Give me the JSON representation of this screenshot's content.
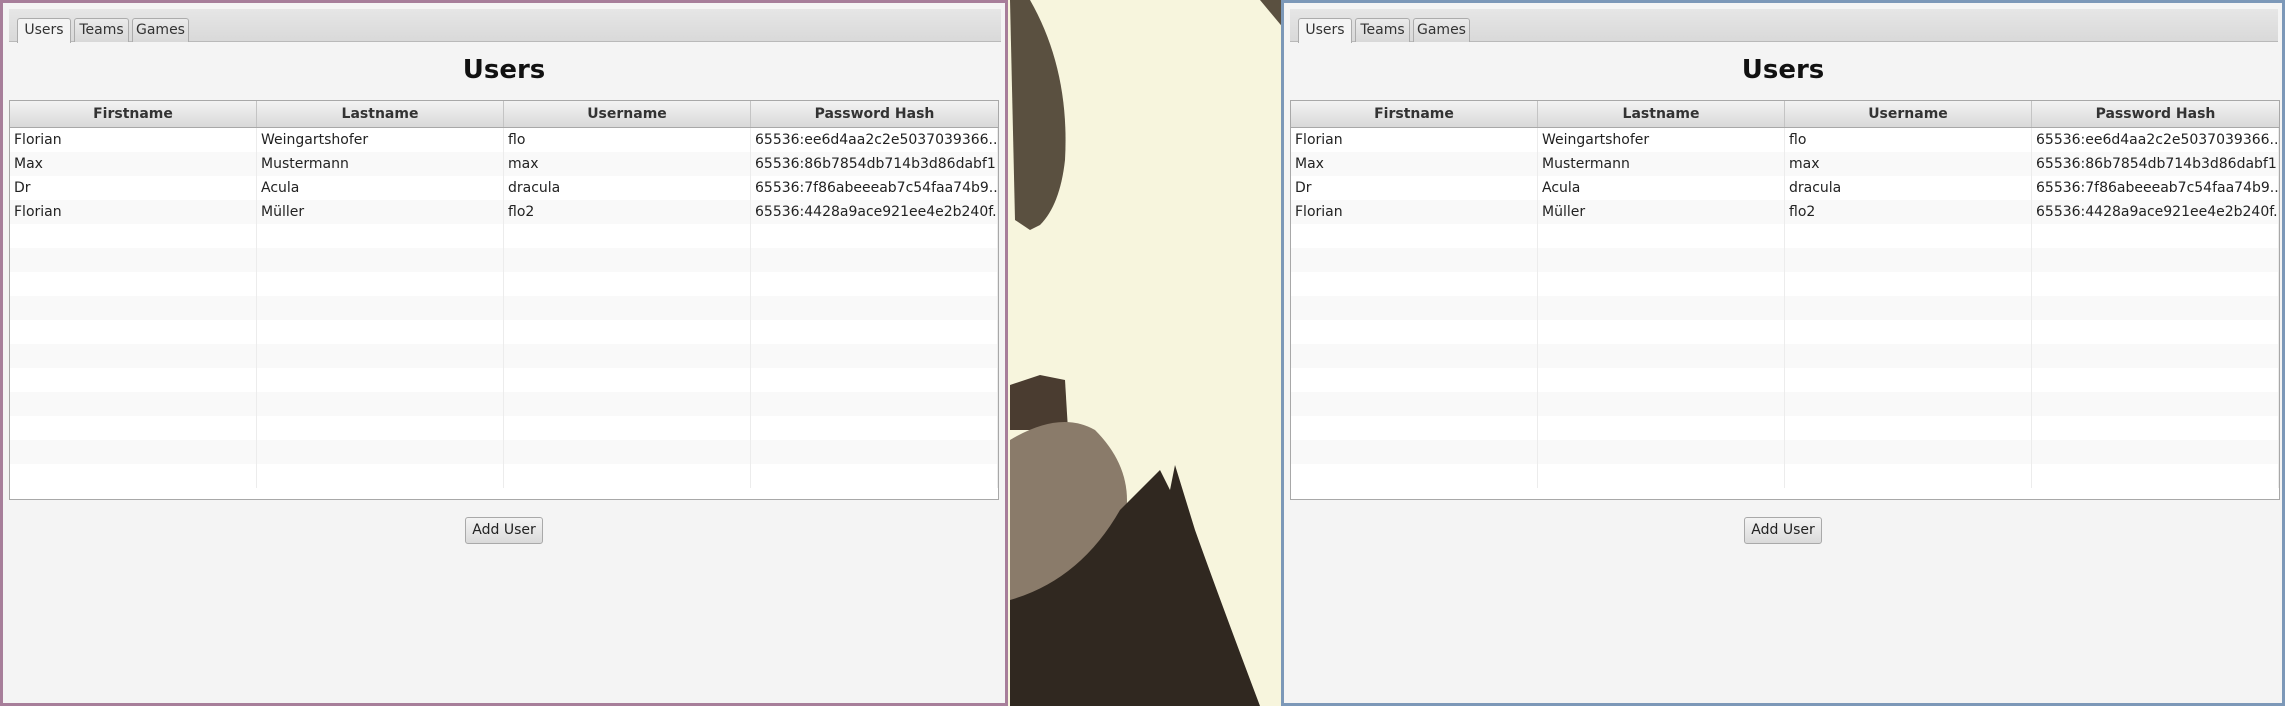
{
  "colors": {
    "wallpaper": "#f7f5dd",
    "window_left_border": "#a77e9a",
    "window_right_border": "#7c98b8"
  },
  "tabs": [
    "Users",
    "Teams",
    "Games"
  ],
  "page_title": "Users",
  "columns": [
    "Firstname",
    "Lastname",
    "Username",
    "Password Hash"
  ],
  "rows": [
    [
      "Florian",
      "Weingartshofer",
      "flo",
      "65536:ee6d4aa2c2e5037039366..."
    ],
    [
      "Max",
      "Mustermann",
      "max",
      "65536:86b7854db714b3d86dabf1..."
    ],
    [
      "Dr",
      "Acula",
      "dracula",
      "65536:7f86abeeeab7c54faa74b9..."
    ],
    [
      "Florian",
      "Müller",
      "flo2",
      "65536:4428a9ace921ee4e2b240f..."
    ]
  ],
  "add_user_label": "Add User"
}
